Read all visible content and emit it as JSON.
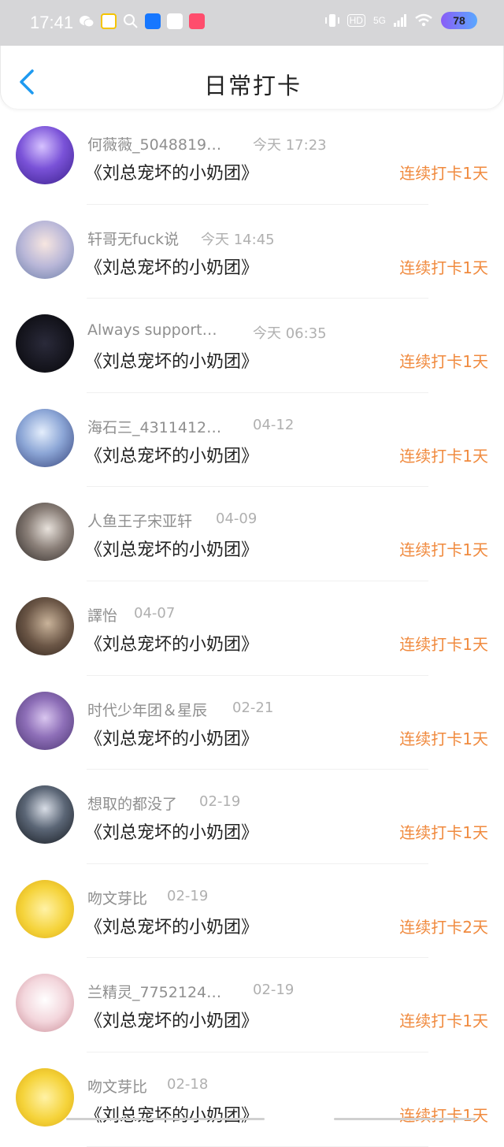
{
  "status_bar": {
    "time": "17:41",
    "left_icons": [
      "wechat-icon",
      "sticker-app-icon",
      "search-icon",
      "alipay-icon",
      "mail-icon",
      "app-icon"
    ],
    "signal_label": "5G",
    "hd_label": "HD",
    "battery": "78"
  },
  "header": {
    "title": "日常打卡",
    "back_icon": "chevron-left-icon"
  },
  "colors": {
    "accent_blue": "#1e9af0",
    "streak_orange": "#f08a3e",
    "name_gray": "#8f8f8f"
  },
  "checkins": [
    {
      "user": "何薇薇_5048819…",
      "time": "今天 17:23",
      "book": "《刘总宠坏的小奶团》",
      "streak": "连续打卡1天"
    },
    {
      "user": "轩哥无fuck说",
      "time": "今天 14:45",
      "book": "《刘总宠坏的小奶团》",
      "streak": "连续打卡1天"
    },
    {
      "user": "Always support…",
      "time": "今天 06:35",
      "book": "《刘总宠坏的小奶团》",
      "streak": "连续打卡1天"
    },
    {
      "user": "海石三_4311412…",
      "time": "04-12",
      "book": "《刘总宠坏的小奶团》",
      "streak": "连续打卡1天"
    },
    {
      "user": "人鱼王子宋亚轩",
      "time": "04-09",
      "book": "《刘总宠坏的小奶团》",
      "streak": "连续打卡1天"
    },
    {
      "user": "譯怡",
      "time": "04-07",
      "book": "《刘总宠坏的小奶团》",
      "streak": "连续打卡1天"
    },
    {
      "user": "时代少年团＆星辰",
      "time": "02-21",
      "book": "《刘总宠坏的小奶团》",
      "streak": "连续打卡1天"
    },
    {
      "user": "想取的都没了",
      "time": "02-19",
      "book": "《刘总宠坏的小奶团》",
      "streak": "连续打卡1天"
    },
    {
      "user": "吻文芽比",
      "time": "02-19",
      "book": "《刘总宠坏的小奶团》",
      "streak": "连续打卡2天"
    },
    {
      "user": "兰精灵_7752124…",
      "time": "02-19",
      "book": "《刘总宠坏的小奶团》",
      "streak": "连续打卡1天"
    },
    {
      "user": "吻文芽比",
      "time": "02-18",
      "book": "《刘总宠坏的小奶团》",
      "streak": "连续打卡1天"
    }
  ]
}
